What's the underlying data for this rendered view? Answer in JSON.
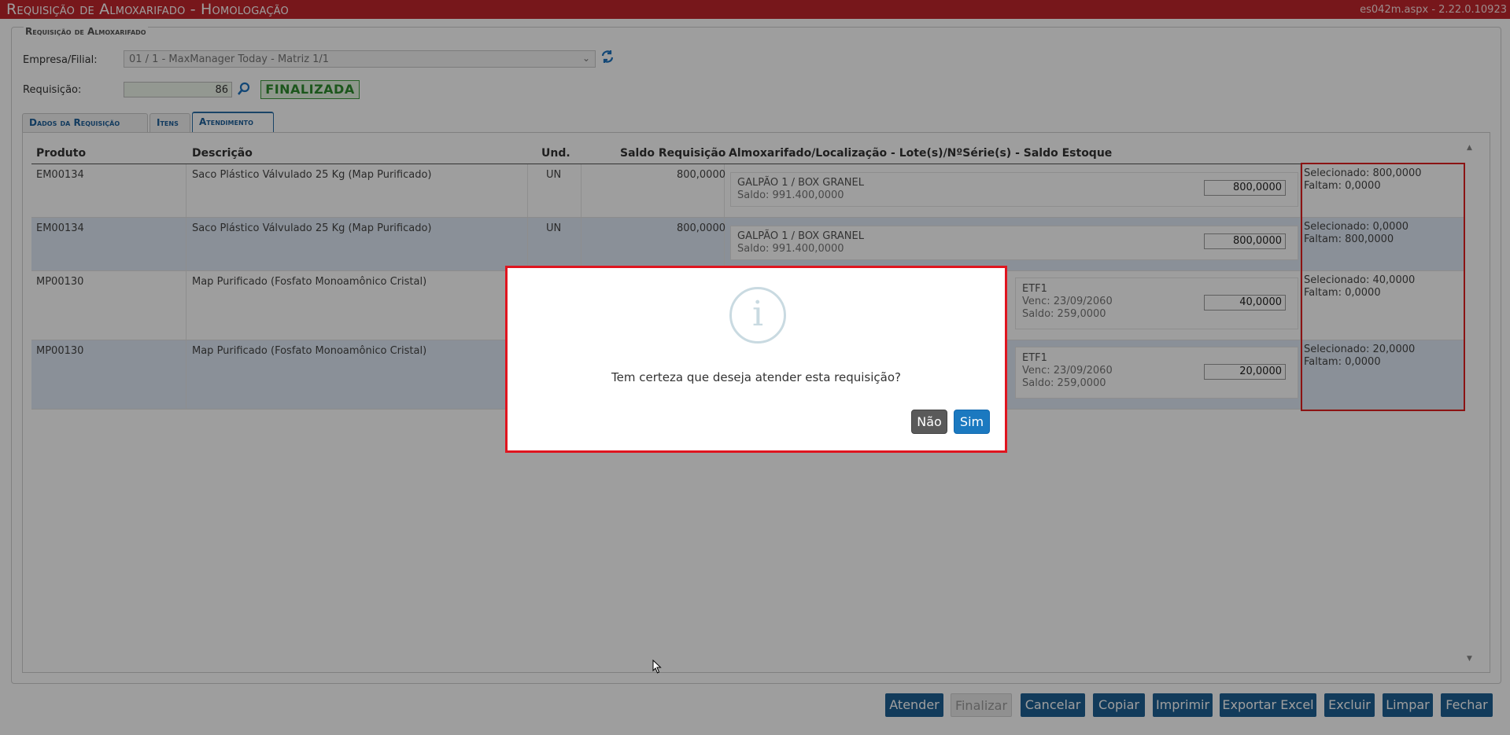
{
  "header": {
    "title": "Requisição de Almoxarifado  - Homologação",
    "version": "es042m.aspx - 2.22.0.10923"
  },
  "form": {
    "legend": "Requisição de Almoxarifado",
    "empresa_label": "Empresa/Filial:",
    "empresa_value": "01 / 1 - MaxManager Today - Matriz 1/1",
    "requisicao_label": "Requisição:",
    "requisicao_value": "86",
    "status": "FINALIZADA"
  },
  "tabs": [
    {
      "label": "Dados da Requisição",
      "active": false
    },
    {
      "label": "Itens",
      "active": false
    },
    {
      "label": "Atendimento",
      "active": true
    }
  ],
  "grid": {
    "columns": [
      "Produto",
      "Descrição",
      "Und.",
      "Saldo Requisição",
      "Almoxarifado/Localização - Lote(s)/NºSérie(s) - Saldo Estoque"
    ],
    "rows": [
      {
        "produto": "EM00134",
        "descricao": "Saco Plástico Válvulado 25 Kg (Map Purificado)",
        "und": "UN",
        "saldo": "800,0000",
        "local": "GALPÃO 1 / BOX GRANEL",
        "local_saldo": "Saldo: 991.400,0000",
        "qty": "800,0000",
        "selecionado": "Selecionado: 800,0000",
        "faltam": "Faltam: 0,0000"
      },
      {
        "produto": "EM00134",
        "descricao": "Saco Plástico Válvulado 25 Kg (Map Purificado)",
        "und": "UN",
        "saldo": "800,0000",
        "local": "GALPÃO 1 / BOX GRANEL",
        "local_saldo": "Saldo: 991.400,0000",
        "qty": "800,0000",
        "selecionado": "Selecionado: 0,0000",
        "faltam": "Faltam: 800,0000"
      },
      {
        "produto": "MP00130",
        "descricao": "Map Purificado (Fosfato Monoamônico Cristal)",
        "und": "",
        "saldo": "",
        "lote": "ETF1",
        "venc": "Venc: 23/09/2060",
        "local_saldo": "Saldo: 259,0000",
        "qty": "40,0000",
        "selecionado": "Selecionado: 40,0000",
        "faltam": "Faltam: 0,0000"
      },
      {
        "produto": "MP00130",
        "descricao": "Map Purificado (Fosfato Monoamônico Cristal)",
        "und": "",
        "saldo": "",
        "lote": "ETF1",
        "venc": "Venc: 23/09/2060",
        "local_saldo": "Saldo: 259,0000",
        "qty": "20,0000",
        "selecionado": "Selecionado: 20,0000",
        "faltam": "Faltam: 0,0000"
      }
    ]
  },
  "buttons": {
    "atender": "Atender",
    "finalizar": "Finalizar",
    "cancelar": "Cancelar",
    "copiar": "Copiar",
    "imprimir": "Imprimir",
    "exportar": "Exportar Excel",
    "excluir": "Excluir",
    "limpar": "Limpar",
    "fechar": "Fechar"
  },
  "dialog": {
    "icon": "info-icon",
    "message": "Tem certeza que deseja atender esta requisição?",
    "no_label": "Não",
    "yes_label": "Sim"
  },
  "colors": {
    "header_bg": "#c0262c",
    "button_bg": "#1d5f93",
    "highlight_border": "#e0151f",
    "status_green": "#2e8b2e"
  }
}
